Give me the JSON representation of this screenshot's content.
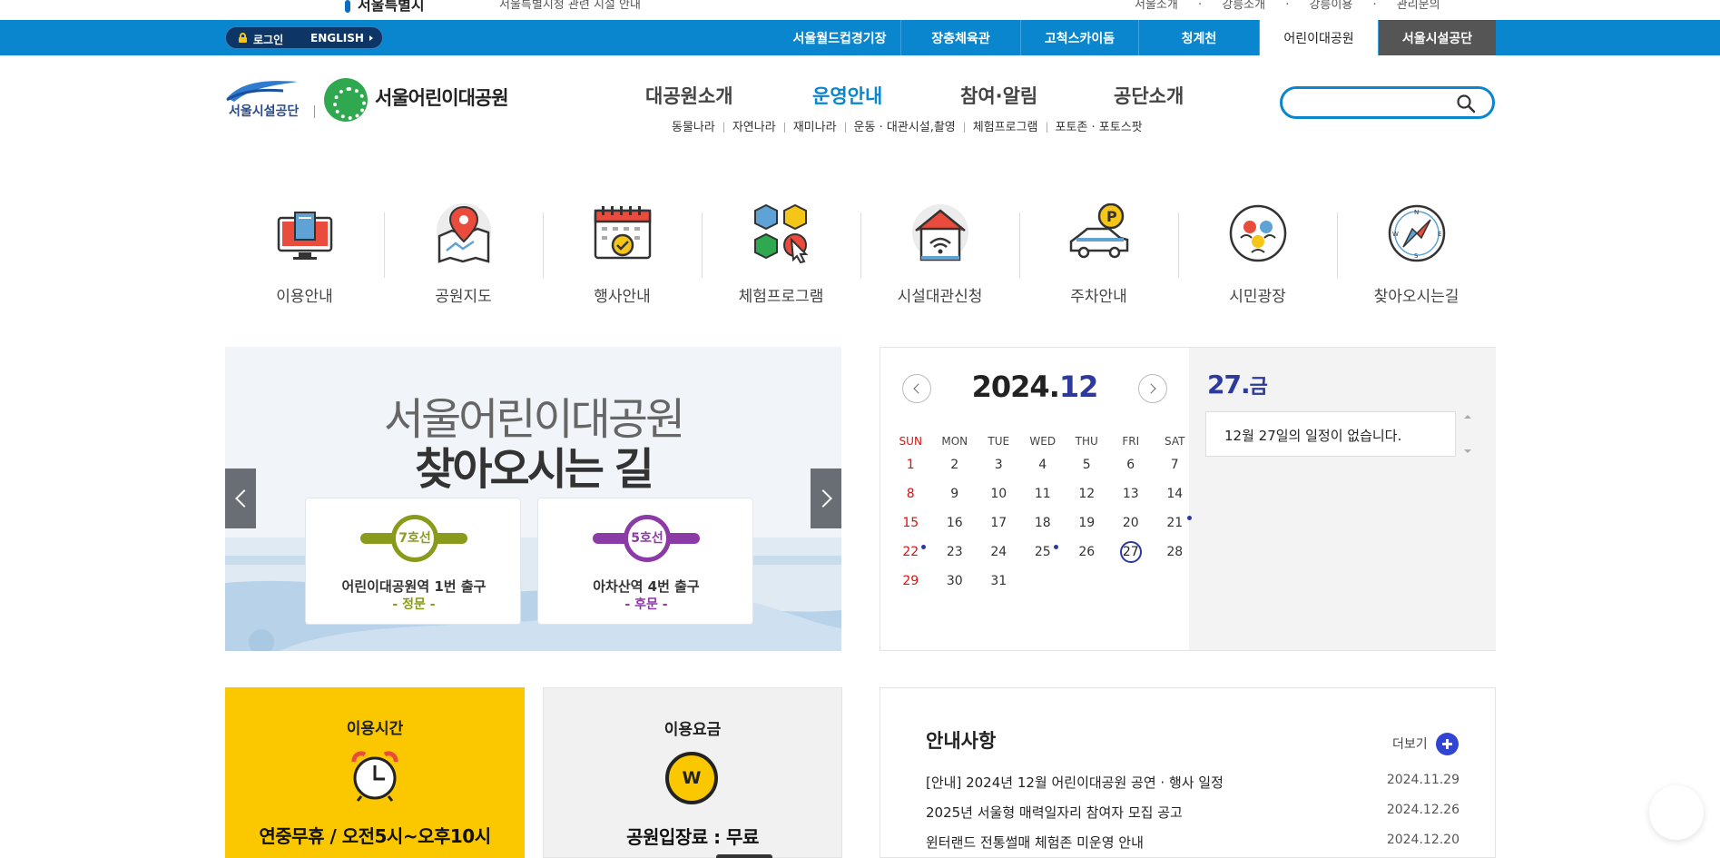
{
  "top": {
    "city": "서울특별시",
    "news": "서울특별시청 관련 시설 안내",
    "utils": "서울소개 · 강릉소개 · 강릉이용 · 관리문의"
  },
  "utilbar": {
    "login": "로그인",
    "english": "ENGLISH",
    "sites": [
      "서울월드컵경기장",
      "장충체육관",
      "고척스카이돔",
      "청계천",
      "어린이대공원",
      "서울시설공단"
    ]
  },
  "header": {
    "logo1": "서울시설공단",
    "logo2": "서울어린이대공원",
    "gnb": [
      "대공원소개",
      "운영안내",
      "참여·알림",
      "공단소개"
    ],
    "subnav": [
      "동물나라",
      "자연나라",
      "재미나라",
      "운동 · 대관시설,촬영",
      "체험프로그램",
      "포토존 · 포토스팟"
    ],
    "search_placeholder": ""
  },
  "quick": [
    {
      "label": "이용안내",
      "icon": "computer-book-icon"
    },
    {
      "label": "공원지도",
      "icon": "map-pin-icon"
    },
    {
      "label": "행사안내",
      "icon": "calendar-check-icon"
    },
    {
      "label": "체험프로그램",
      "icon": "cubes-cursor-icon"
    },
    {
      "label": "시설대관신청",
      "icon": "house-wifi-icon"
    },
    {
      "label": "주차안내",
      "icon": "car-parking-icon"
    },
    {
      "label": "시민광장",
      "icon": "people-cycle-icon"
    },
    {
      "label": "찾아오시는길",
      "icon": "compass-icon"
    }
  ],
  "banner": {
    "line1": "서울어린이대공원",
    "line2": "찾아오시는 길",
    "cards": [
      {
        "line": "7호선",
        "station": "어린이대공원역 1번 출구",
        "gate": "- 정문 -",
        "color": "#8a9a1b"
      },
      {
        "line": "5호선",
        "station": "아차산역 4번 출구",
        "gate": "- 후문 -",
        "color": "#8c3aa5"
      }
    ]
  },
  "calendar": {
    "year": "2024.",
    "month": "12",
    "weekdays": [
      "SUN",
      "MON",
      "TUE",
      "WED",
      "THU",
      "FRI",
      "SAT"
    ],
    "weeks": [
      [
        "1",
        "2",
        "3",
        "4",
        "5",
        "6",
        "7"
      ],
      [
        "8",
        "9",
        "10",
        "11",
        "12",
        "13",
        "14"
      ],
      [
        "15",
        "16",
        "17",
        "18",
        "19",
        "20",
        "21"
      ],
      [
        "22",
        "23",
        "24",
        "25",
        "26",
        "27",
        "28"
      ],
      [
        "29",
        "30",
        "31",
        "",
        "",
        "",
        ""
      ]
    ],
    "today": "27",
    "event_days": [
      "21",
      "22",
      "25"
    ],
    "selected_day": "27.",
    "selected_weekday": "금",
    "no_event": "12월 27일의 일정이 없습니다."
  },
  "hours": {
    "title": "이용시간",
    "value": "연중무휴 / 오전5시~오후10시"
  },
  "fee": {
    "title": "이용요금",
    "coin": "W",
    "value": "공원입장료 : 무료"
  },
  "notice": {
    "title": "안내사항",
    "more": "더보기",
    "items": [
      {
        "title": "[안내] 2024년 12월 어린이대공원 공연 · 행사 일정",
        "date": "2024.11.29"
      },
      {
        "title": "2025년 서울형 매력일자리 참여자 모집 공고",
        "date": "2024.12.26"
      },
      {
        "title": "윈터랜드 전통썰매 체험존 미운영 안내",
        "date": "2024.12.20"
      }
    ]
  }
}
